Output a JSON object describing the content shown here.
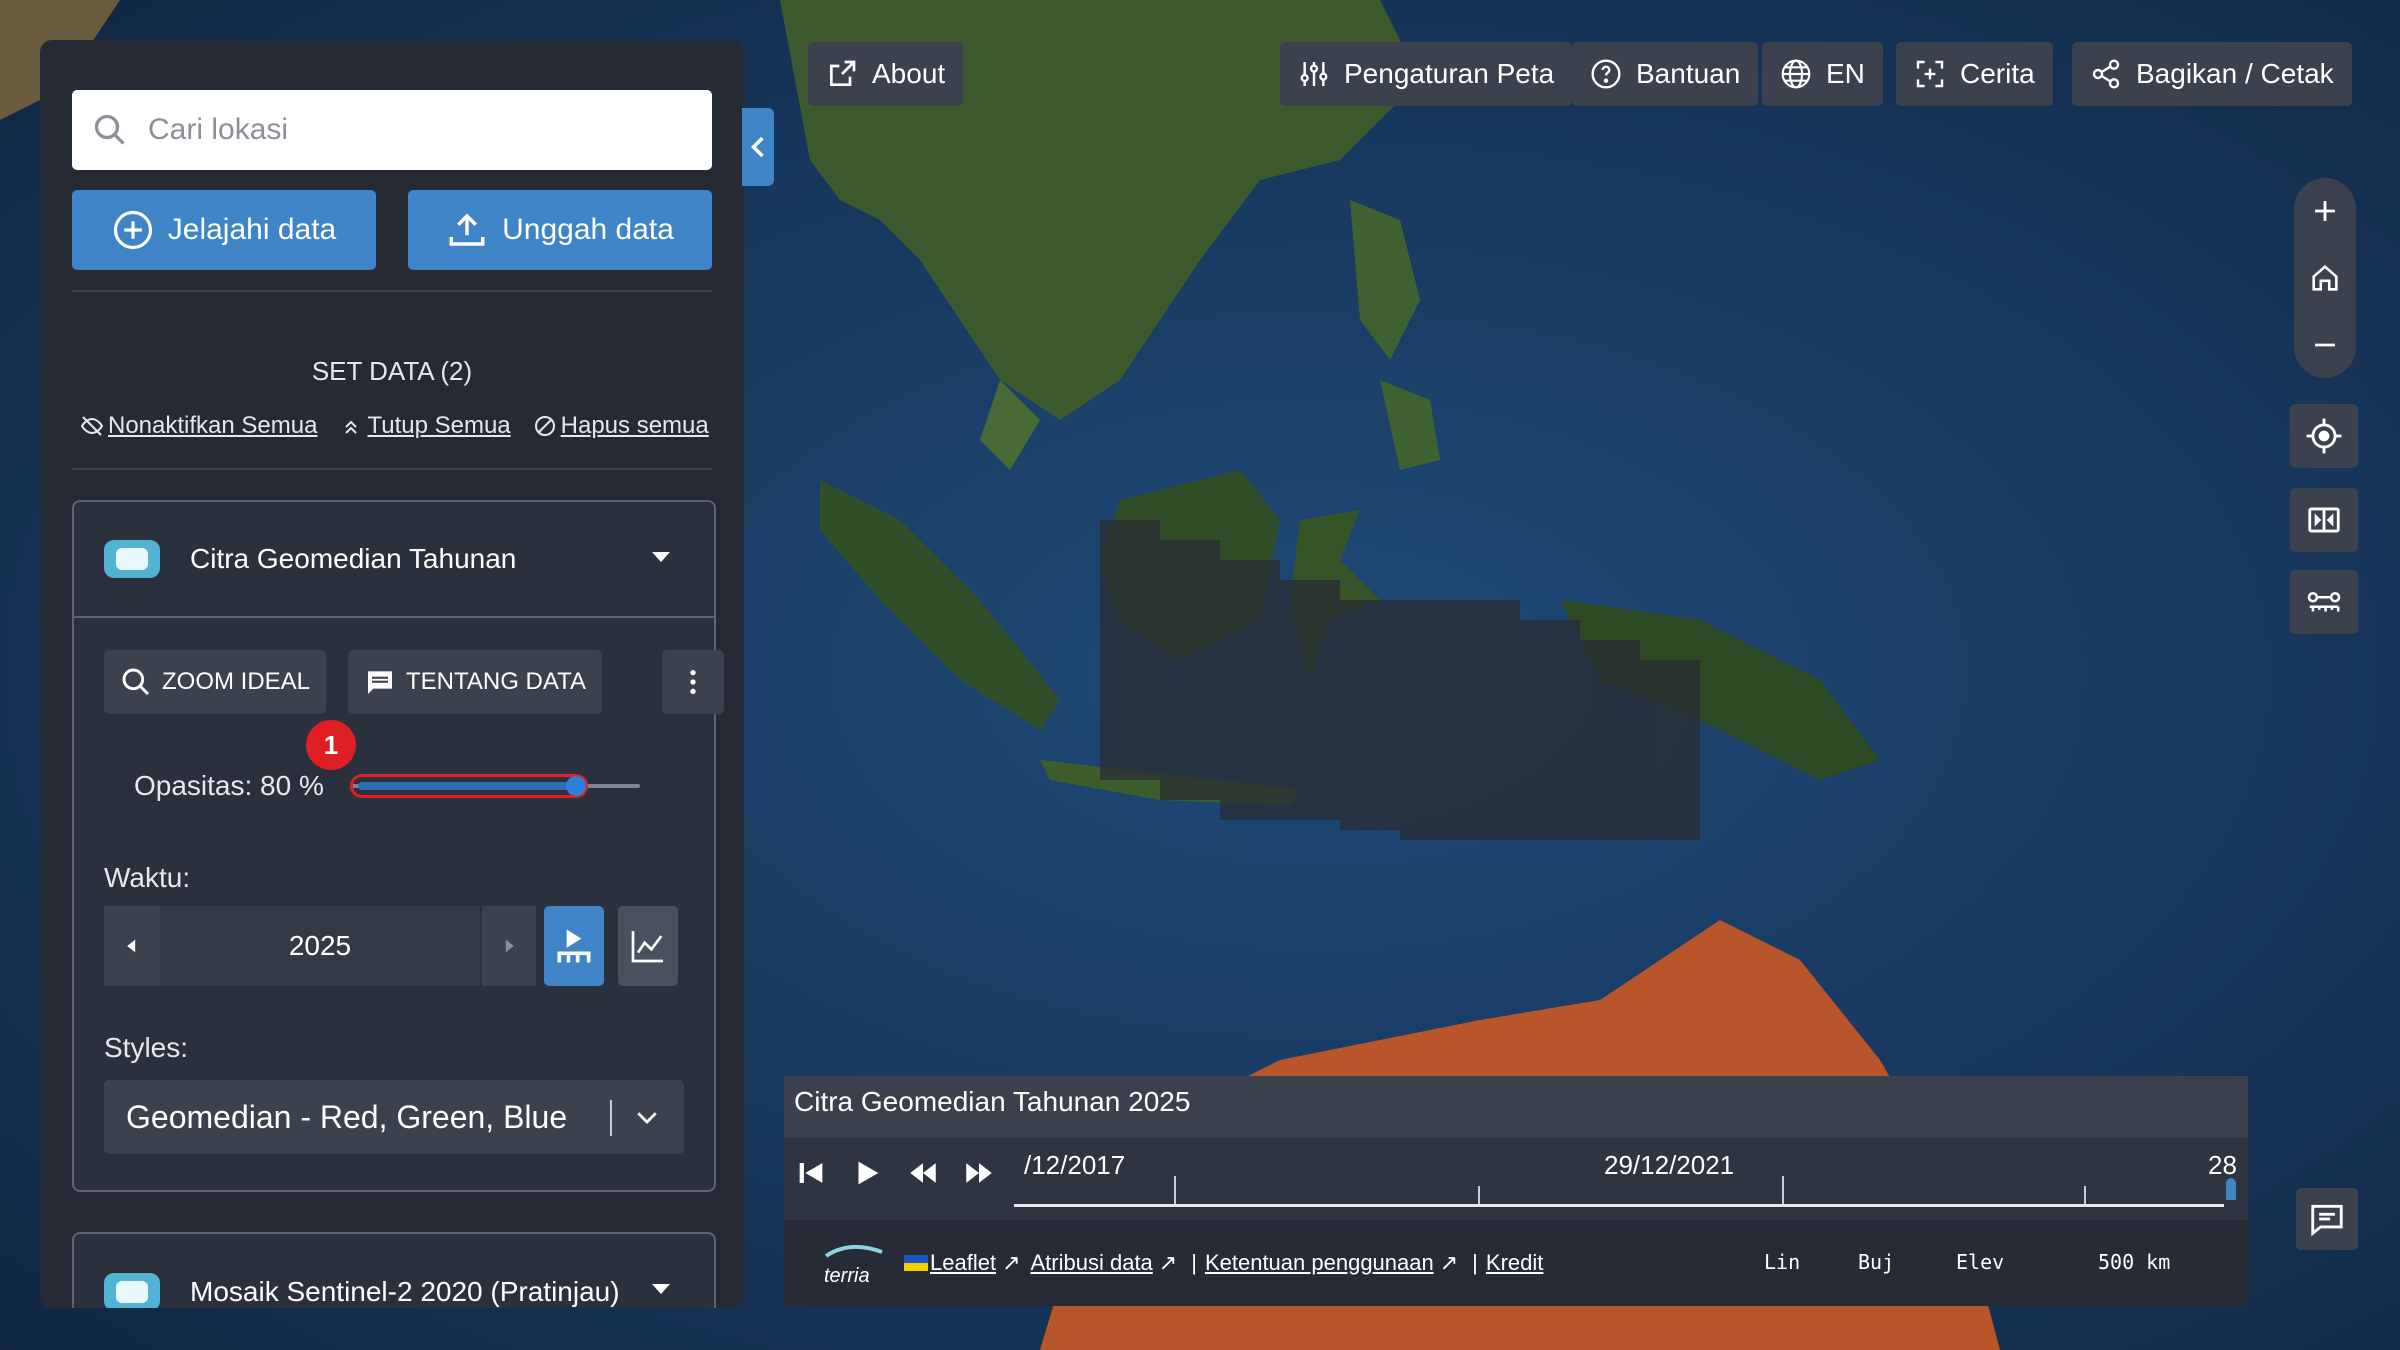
{
  "search": {
    "placeholder": "Cari lokasi"
  },
  "buttons": {
    "explore": "Jelajahi data",
    "upload": "Unggah data"
  },
  "workbench": {
    "title": "SET DATA (2)",
    "actions": {
      "disable_all": "Nonaktifkan Semua",
      "collapse_all": "Tutup Semua",
      "remove_all": "Hapus semua"
    }
  },
  "dataset1": {
    "title": "Citra Geomedian Tahunan",
    "zoom_ideal": "ZOOM IDEAL",
    "about_data": "TENTANG DATA",
    "badge": "1",
    "opacity_label": "Opasitas: 80 %",
    "opacity_value": 0.8,
    "time_label": "Waktu:",
    "time_value": "2025",
    "styles_label": "Styles:",
    "styles_value": "Geomedian - Red, Green, Blue"
  },
  "dataset2": {
    "title": "Mosaik Sentinel-2 2020 (Pratinjau)"
  },
  "topbar": {
    "about": "About",
    "map_settings": "Pengaturan Peta",
    "help": "Bantuan",
    "language": "EN",
    "story": "Cerita",
    "share": "Bagikan / Cetak"
  },
  "timeline": {
    "title": "Citra Geomedian Tahunan 2025",
    "date_start": "/12/2017",
    "date_mid": "29/12/2021",
    "date_end": "28"
  },
  "status": {
    "leaflet": "Leaflet",
    "attribution": "Atribusi data",
    "terms": "Ketentuan penggunaan",
    "credits": "Kredit",
    "lat": "Lin",
    "lon": "Buj",
    "elev": "Elev",
    "scale": "500 km",
    "logo_text": "terria"
  },
  "icons": {
    "search": "search-icon",
    "plus-circle": "add-circle-icon",
    "upload": "upload-icon",
    "eye-off": "eye-off-icon",
    "chevrons-up": "chevrons-up-icon",
    "ban": "ban-icon",
    "zoom": "zoom-icon",
    "comment": "comment-icon",
    "kebab": "more-vert-icon",
    "external": "external-link-icon",
    "sliders": "sliders-icon",
    "help": "help-icon",
    "globe": "globe-icon",
    "story": "story-icon",
    "share": "share-icon",
    "home": "home-icon",
    "locate": "locate-icon",
    "split": "split-icon",
    "measure": "measure-icon",
    "feedback": "feedback-icon"
  },
  "colors": {
    "accent": "#3e84c6",
    "badge": "#e01f25",
    "toggle": "#52b3d4",
    "panel": "#252a34",
    "button": "#3b414d"
  }
}
